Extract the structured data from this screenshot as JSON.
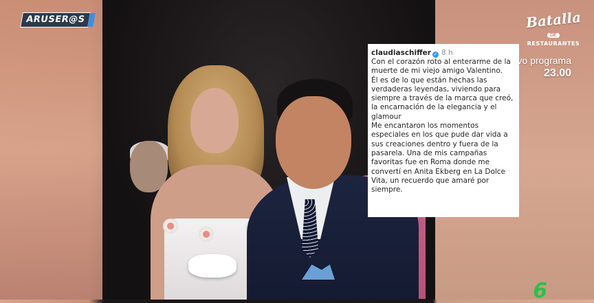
{
  "overlay": {
    "logo_text": "ARUSER@S"
  },
  "branding": {
    "title": "Batalla",
    "de": "DE",
    "subtitle": "RESTAURANTES",
    "program_label": "Nuevo programa",
    "program_time": "23.00",
    "channel_mark": "6"
  },
  "post": {
    "username": "claudiaschiffer",
    "verified_icon": "check-badge-icon",
    "time": "8 h",
    "lines_p1": [
      "Con el corazón roto al enterarme de la",
      "muerte de mi viejo amigo Valentino.",
      "Él es de lo que están hechas las",
      "verdaderas leyendas, viviendo para",
      "siempre a través de la marca que creó,",
      "la encarnación de la elegancia y el",
      "glamour"
    ],
    "lines_p2": [
      "Me encantaron los momentos",
      "especiales en los que pude dar vida a",
      "sus creaciones dentro y fuera de la",
      "pasarela. Una de mis campañas",
      "favoritas fue en Roma donde me",
      "convertí en Anita Ekberg en La Dolce",
      "Vita, un recuerdo que amaré por",
      "siempre."
    ]
  },
  "colors": {
    "verified": "#3897f0",
    "channel": "#27c24a",
    "logo_bg": "#2d3a4b"
  }
}
